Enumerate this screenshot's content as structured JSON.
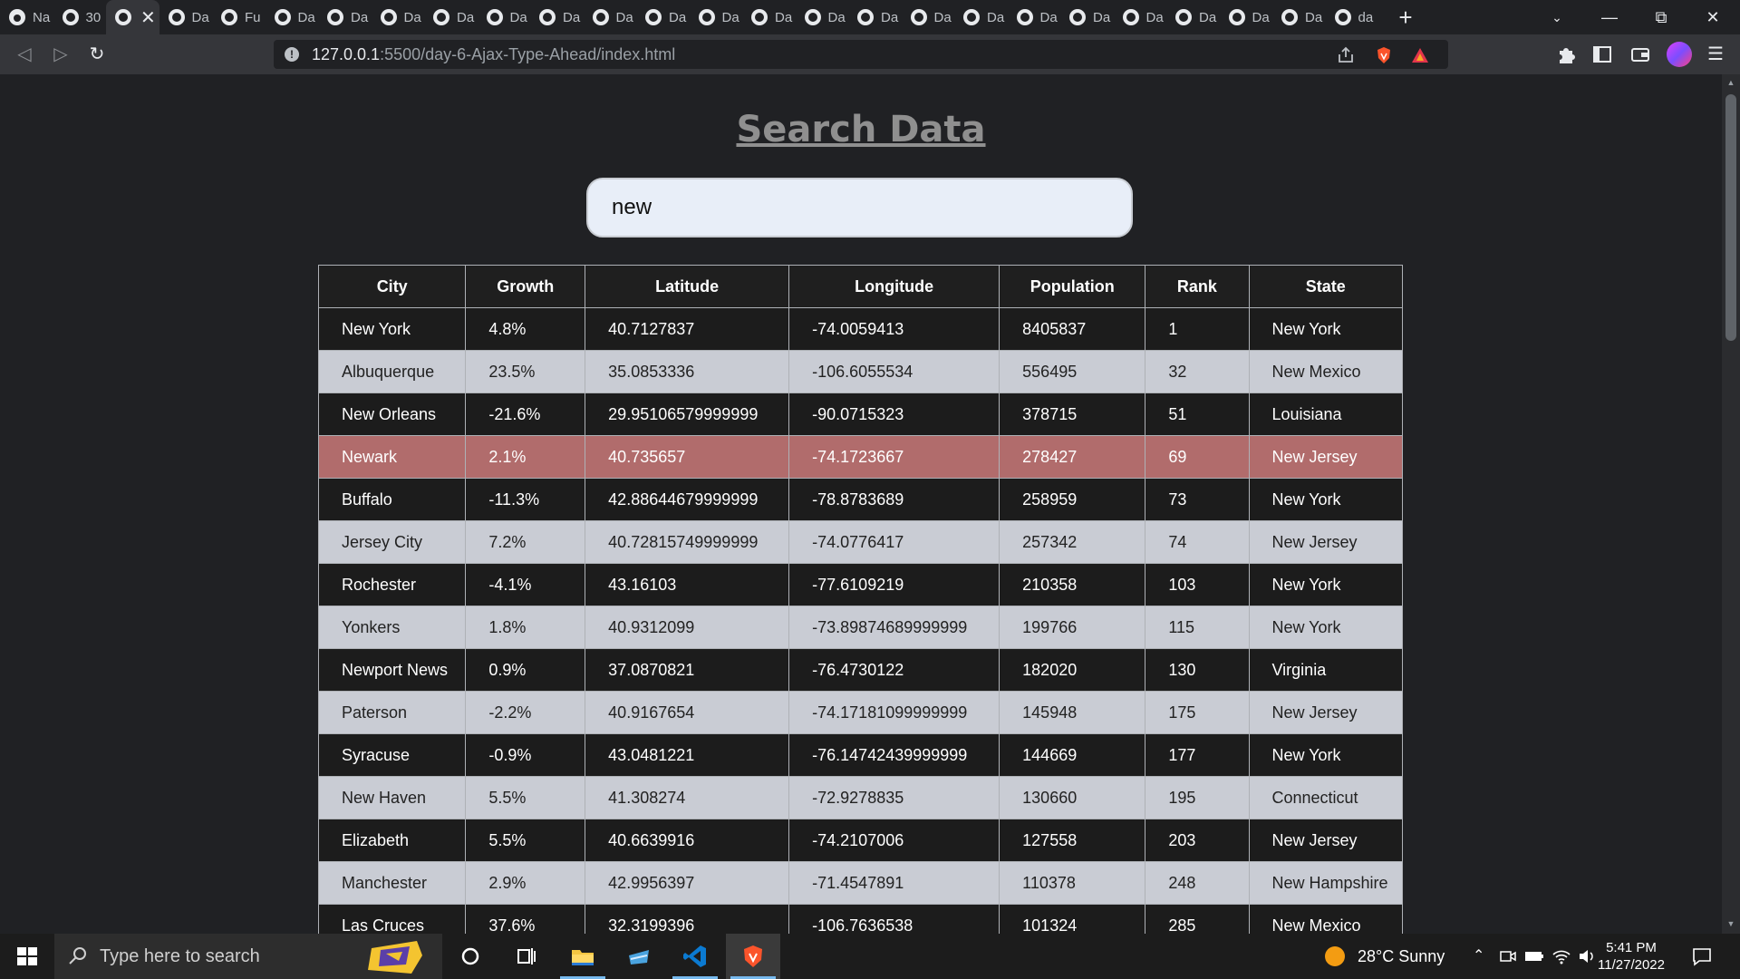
{
  "browser": {
    "tabs": [
      {
        "label": "Na",
        "icon": "github-icon"
      },
      {
        "label": "30",
        "icon": "globe-icon"
      },
      {
        "label": "",
        "icon": "globe-icon",
        "active": true
      },
      {
        "label": "Da",
        "icon": "globe-icon"
      },
      {
        "label": "Fu",
        "icon": "globe-icon"
      },
      {
        "label": "Da",
        "icon": "globe-icon"
      },
      {
        "label": "Da",
        "icon": "globe-icon"
      },
      {
        "label": "Da",
        "icon": "globe-icon"
      },
      {
        "label": "Da",
        "icon": "globe-icon"
      },
      {
        "label": "Da",
        "icon": "globe-icon"
      },
      {
        "label": "Da",
        "icon": "globe-icon"
      },
      {
        "label": "Da",
        "icon": "globe-icon"
      },
      {
        "label": "Da",
        "icon": "globe-icon"
      },
      {
        "label": "Da",
        "icon": "globe-icon"
      },
      {
        "label": "Da",
        "icon": "globe-icon"
      },
      {
        "label": "Da",
        "icon": "globe-icon"
      },
      {
        "label": "Da",
        "icon": "globe-icon"
      },
      {
        "label": "Da",
        "icon": "globe-icon"
      },
      {
        "label": "Da",
        "icon": "globe-icon"
      },
      {
        "label": "Da",
        "icon": "globe-icon"
      },
      {
        "label": "Da",
        "icon": "globe-icon"
      },
      {
        "label": "Da",
        "icon": "globe-icon"
      },
      {
        "label": "Da",
        "icon": "globe-icon"
      },
      {
        "label": "Da",
        "icon": "globe-icon"
      },
      {
        "label": "Da",
        "icon": "globe-icon"
      },
      {
        "label": "da",
        "icon": "globe-icon"
      }
    ],
    "url_host": "127.0.0.1",
    "url_path": ":5500/day-6-Ajax-Type-Ahead/index.html"
  },
  "page": {
    "title": "Search Data",
    "search_value": "new",
    "columns": [
      "City",
      "Growth",
      "Latitude",
      "Longitude",
      "Population",
      "Rank",
      "State"
    ],
    "rows": [
      {
        "city": "New York",
        "growth": "4.8%",
        "lat": "40.7127837",
        "lng": "-74.0059413",
        "pop": "8405837",
        "rank": "1",
        "state": "New York",
        "style": "dark"
      },
      {
        "city": "Albuquerque",
        "growth": "23.5%",
        "lat": "35.0853336",
        "lng": "-106.6055534",
        "pop": "556495",
        "rank": "32",
        "state": "New Mexico",
        "style": "light"
      },
      {
        "city": "New Orleans",
        "growth": "-21.6%",
        "lat": "29.95106579999999",
        "lng": "-90.0715323",
        "pop": "378715",
        "rank": "51",
        "state": "Louisiana",
        "style": "dark"
      },
      {
        "city": "Newark",
        "growth": "2.1%",
        "lat": "40.735657",
        "lng": "-74.1723667",
        "pop": "278427",
        "rank": "69",
        "state": "New Jersey",
        "style": "hl"
      },
      {
        "city": "Buffalo",
        "growth": "-11.3%",
        "lat": "42.88644679999999",
        "lng": "-78.8783689",
        "pop": "258959",
        "rank": "73",
        "state": "New York",
        "style": "dark"
      },
      {
        "city": "Jersey City",
        "growth": "7.2%",
        "lat": "40.72815749999999",
        "lng": "-74.0776417",
        "pop": "257342",
        "rank": "74",
        "state": "New Jersey",
        "style": "light"
      },
      {
        "city": "Rochester",
        "growth": "-4.1%",
        "lat": "43.16103",
        "lng": "-77.6109219",
        "pop": "210358",
        "rank": "103",
        "state": "New York",
        "style": "dark"
      },
      {
        "city": "Yonkers",
        "growth": "1.8%",
        "lat": "40.9312099",
        "lng": "-73.89874689999999",
        "pop": "199766",
        "rank": "115",
        "state": "New York",
        "style": "light"
      },
      {
        "city": "Newport News",
        "growth": "0.9%",
        "lat": "37.0870821",
        "lng": "-76.4730122",
        "pop": "182020",
        "rank": "130",
        "state": "Virginia",
        "style": "dark"
      },
      {
        "city": "Paterson",
        "growth": "-2.2%",
        "lat": "40.9167654",
        "lng": "-74.17181099999999",
        "pop": "145948",
        "rank": "175",
        "state": "New Jersey",
        "style": "light"
      },
      {
        "city": "Syracuse",
        "growth": "-0.9%",
        "lat": "43.0481221",
        "lng": "-76.14742439999999",
        "pop": "144669",
        "rank": "177",
        "state": "New York",
        "style": "dark"
      },
      {
        "city": "New Haven",
        "growth": "5.5%",
        "lat": "41.308274",
        "lng": "-72.9278835",
        "pop": "130660",
        "rank": "195",
        "state": "Connecticut",
        "style": "light"
      },
      {
        "city": "Elizabeth",
        "growth": "5.5%",
        "lat": "40.6639916",
        "lng": "-74.2107006",
        "pop": "127558",
        "rank": "203",
        "state": "New Jersey",
        "style": "dark"
      },
      {
        "city": "Manchester",
        "growth": "2.9%",
        "lat": "42.9956397",
        "lng": "-71.4547891",
        "pop": "110378",
        "rank": "248",
        "state": "New Hampshire",
        "style": "light"
      },
      {
        "city": "Las Cruces",
        "growth": "37.6%",
        "lat": "32.3199396",
        "lng": "-106.7636538",
        "pop": "101324",
        "rank": "285",
        "state": "New Mexico",
        "style": "dark"
      }
    ]
  },
  "taskbar": {
    "search_placeholder": "Type here to search",
    "weather": "28°C  Sunny",
    "time": "5:41 PM",
    "date": "11/27/2022"
  }
}
